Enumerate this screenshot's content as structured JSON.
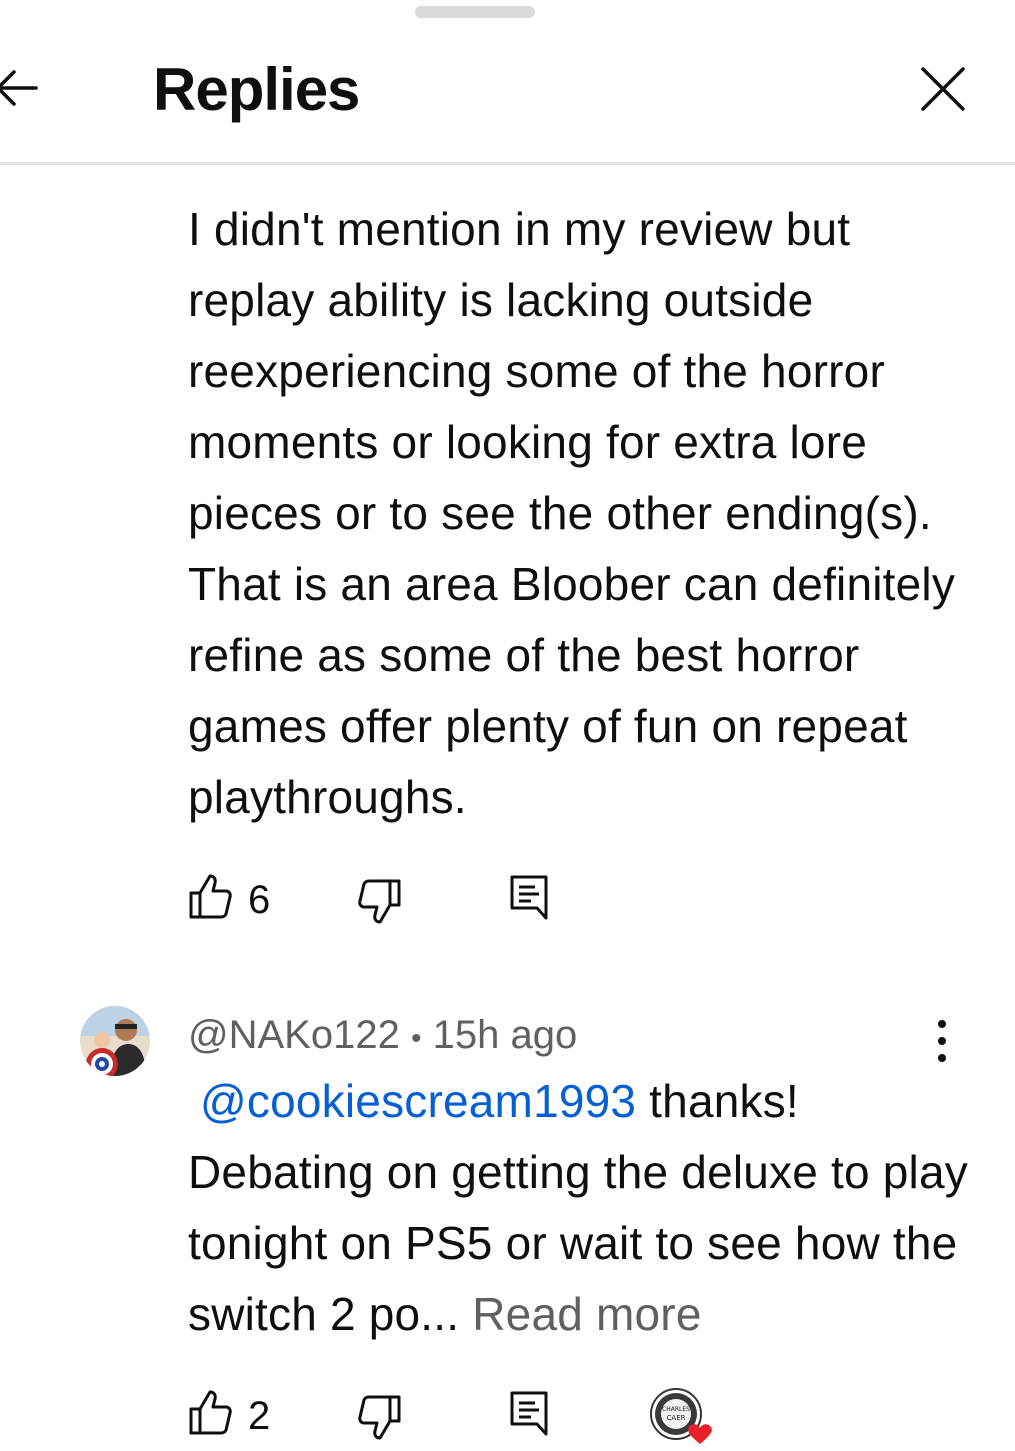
{
  "header": {
    "title": "Replies",
    "back_icon": "arrow-left-icon",
    "close_icon": "close-icon"
  },
  "comment1": {
    "body": "I didn't mention in my review but replay ability is lacking outside reexperiencing some of the horror moments or looking for extra lore pieces or to see the other ending(s). That is an area Bloober can definitely refine as some of the best horror games offer plenty of fun on repeat playthroughs.",
    "likes": "6"
  },
  "comment2": {
    "author": "@NAKo122",
    "separator": "•",
    "time": "15h ago",
    "mention": "@cookiescream1993",
    "body": " thanks! Debating on getting the deluxe to play tonight on PS5 or wait to see how the switch 2 po...",
    "read_more": "Read more",
    "likes": "2",
    "creator_badge_text": "CHARLES CAER"
  },
  "colors": {
    "link": "#065fd4",
    "secondary_text": "#606060",
    "heart": "#e8202a"
  }
}
